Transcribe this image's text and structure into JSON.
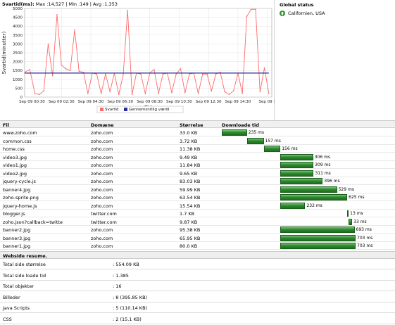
{
  "chart": {
    "title_bold": "Svartid(ms):",
    "title_rest": " Max :14,527 | Min :149 | Avg :1,353",
    "ylabel": "Svartid(minutter)",
    "xlabel": "Tid",
    "legend": [
      "Svartid",
      "Gennemsnitlig værdi"
    ]
  },
  "chart_data": {
    "type": "line",
    "ylim": [
      0,
      5000
    ],
    "yticks": [
      0,
      500,
      1000,
      1500,
      2000,
      2500,
      3000,
      3500,
      4000,
      4500,
      5000
    ],
    "xlim": [
      0,
      9.1
    ],
    "xtick_positions": [
      0.5,
      2.5,
      4.5,
      6.5,
      8.5,
      10.5,
      12.5,
      14.5,
      16.5
    ],
    "xtick_labels": [
      "Sep 09 00:30",
      "Sep 09 02:30",
      "Sep 09 04:30",
      "Sep 09 06:30",
      "Sep 09 08:30",
      "Sep 09 10:30",
      "Sep 09 12:30",
      "Sep 09 14:30",
      "Sep 09 1"
    ],
    "grid": true,
    "legend_position": "bottom",
    "colors": {
      "svartid": "#ff6a6a",
      "avg": "#2a2a9a"
    },
    "series": [
      {
        "name": "Svartid",
        "x": [
          0,
          0.35,
          0.7,
          1.0,
          1.3,
          1.6,
          1.9,
          2.2,
          2.5,
          2.8,
          3.1,
          3.4,
          3.7,
          4.0,
          4.3,
          4.6,
          4.9,
          5.2,
          5.5,
          5.8,
          6.1,
          6.4,
          6.7,
          7.0,
          7.3,
          7.6,
          7.9,
          8.2,
          8.5,
          8.8,
          9.1,
          9.4,
          9.7,
          10.0,
          10.3,
          10.6,
          10.9,
          11.2,
          11.5,
          11.8,
          12.1,
          12.4,
          12.7,
          13.0,
          13.3,
          13.6,
          13.9,
          14.2,
          14.5,
          14.8,
          15.1,
          15.4,
          15.7,
          16.0,
          16.3,
          16.6
        ],
        "values": [
          1400,
          1550,
          200,
          150,
          350,
          3000,
          1200,
          4650,
          1800,
          1600,
          1500,
          3800,
          1450,
          1400,
          200,
          1350,
          1300,
          200,
          1300,
          300,
          1350,
          150,
          1250,
          4900,
          150,
          1350,
          1300,
          200,
          1350,
          1550,
          200,
          1300,
          1350,
          250,
          1300,
          1600,
          250,
          1300,
          1350,
          200,
          1300,
          1300,
          350,
          1300,
          1400,
          300,
          150,
          350,
          1350,
          200,
          4550,
          4950,
          4950,
          300,
          1650,
          200
        ]
      },
      {
        "name": "Gennemsnitlig værdi",
        "x": [
          0,
          16.6
        ],
        "values": [
          1353,
          1353
        ]
      }
    ]
  },
  "status": {
    "title": "Global status",
    "location": "Californien, USA",
    "icon": "up-arrow-icon"
  },
  "waterfall": {
    "headers": {
      "file": "Fil",
      "domain": "Domæne",
      "size": "Størrelse",
      "time": "Downloade tid"
    },
    "scale_max_ms": 1580,
    "rows": [
      {
        "file": "www.zoho.com",
        "domain": "zoho.com",
        "size": "33.0 KB",
        "start": 0,
        "ms": 235,
        "label": "235 ms"
      },
      {
        "file": "common.css",
        "domain": "zoho.com",
        "size": "3.72 KB",
        "start": 235,
        "ms": 157,
        "label": "157 ms"
      },
      {
        "file": "home.css",
        "domain": "zoho.com",
        "size": "11.38 KB",
        "start": 392,
        "ms": 156,
        "label": "156 ms"
      },
      {
        "file": "video3.jpg",
        "domain": "zoho.com",
        "size": "9.49 KB",
        "start": 548,
        "ms": 306,
        "label": "306 ms"
      },
      {
        "file": "video1.jpg",
        "domain": "zoho.com",
        "size": "11.84 KB",
        "start": 548,
        "ms": 309,
        "label": "309 ms"
      },
      {
        "file": "video2.jpg",
        "domain": "zoho.com",
        "size": "9.65 KB",
        "start": 548,
        "ms": 311,
        "label": "311 ms"
      },
      {
        "file": "jquery-cycle.js",
        "domain": "zoho.com",
        "size": "83.03 KB",
        "start": 548,
        "ms": 396,
        "label": "396 ms"
      },
      {
        "file": "banner4.jpg",
        "domain": "zoho.com",
        "size": "59.99 KB",
        "start": 548,
        "ms": 529,
        "label": "529 ms"
      },
      {
        "file": "zoho-sprite.png",
        "domain": "zoho.com",
        "size": "63.54 KB",
        "start": 548,
        "ms": 625,
        "label": "625 ms"
      },
      {
        "file": "jquery-home.js",
        "domain": "zoho.com",
        "size": "15.54 KB",
        "start": 548,
        "ms": 232,
        "label": "232 ms"
      },
      {
        "file": "blogger.js",
        "domain": "twitter.com",
        "size": "1.7 KB",
        "start": 1173,
        "ms": 13,
        "label": "13 ms"
      },
      {
        "file": "zoho.json?callback=twitte",
        "domain": "twitter.com",
        "size": "9.87 KB",
        "start": 1186,
        "ms": 33,
        "label": "33 ms"
      },
      {
        "file": "banner2.jpg",
        "domain": "zoho.com",
        "size": "95.38 KB",
        "start": 548,
        "ms": 693,
        "label": "693 ms"
      },
      {
        "file": "banner3.jpg",
        "domain": "zoho.com",
        "size": "65.95 KB",
        "start": 548,
        "ms": 703,
        "label": "703 ms"
      },
      {
        "file": "banner1.jpg",
        "domain": "zoho.com",
        "size": "80.0 KB",
        "start": 548,
        "ms": 703,
        "label": "703 ms"
      },
      {
        "file": "getLocale",
        "domain": "zoho.com",
        "size": "13 b",
        "start": 1251,
        "ms": 161,
        "label": "161 ms"
      }
    ]
  },
  "summary": {
    "title": "Webside resume.",
    "rows": [
      {
        "label": "Total side størrelse",
        "value": ": 554.09 KB"
      },
      {
        "label": "Total side loade tid",
        "value": ": 1.385"
      },
      {
        "label": "Total objekter",
        "value": ": 16"
      },
      {
        "label": "Billeder",
        "value": ": 8 (395.85 KB)"
      },
      {
        "label": "Java Scripts",
        "value": ": 5 (110.14 KB)"
      },
      {
        "label": "CSS",
        "value": ": 2 (15.1 KB)"
      }
    ]
  }
}
